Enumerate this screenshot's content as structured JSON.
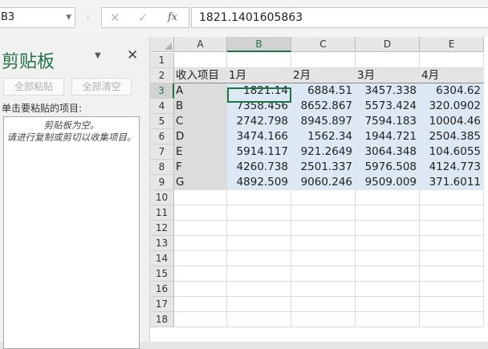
{
  "formula_bar": {
    "name_box": "B3",
    "formula": "1821.1401605863",
    "cancel_symbol": "✕",
    "confirm_symbol": "✓",
    "fx_label": "fx"
  },
  "clipboard_pane": {
    "title": "剪贴板",
    "paste_all": "全部粘贴",
    "clear_all": "全部清空",
    "hint": "单击要粘贴的项目:",
    "empty_line1": "剪贴板为空。",
    "empty_line2": "请进行复制或剪切以收集项目。"
  },
  "sheet": {
    "active_cell": "B3",
    "columns": [
      "A",
      "B",
      "C",
      "D",
      "E"
    ],
    "row_numbers": [
      1,
      2,
      3,
      4,
      5,
      6,
      7,
      8,
      9,
      10,
      11,
      12,
      13,
      14,
      15,
      16,
      17,
      18
    ],
    "header_row": [
      "收入项目",
      "1月",
      "2月",
      "3月",
      "4月"
    ],
    "data_rows": [
      {
        "label": "A",
        "values": [
          "1821.14",
          "6884.51",
          "3457.338",
          "6304.62"
        ]
      },
      {
        "label": "B",
        "values": [
          "7358.456",
          "8652.867",
          "5573.424",
          "320.0902"
        ]
      },
      {
        "label": "C",
        "values": [
          "2742.798",
          "8945.897",
          "7594.183",
          "10004.46"
        ]
      },
      {
        "label": "D",
        "values": [
          "3474.166",
          "1562.34",
          "1944.721",
          "2504.385"
        ]
      },
      {
        "label": "E",
        "values": [
          "5914.117",
          "921.2649",
          "3064.348",
          "104.6055"
        ]
      },
      {
        "label": "F",
        "values": [
          "4260.738",
          "2501.337",
          "5976.508",
          "4124.773"
        ]
      },
      {
        "label": "G",
        "values": [
          "4892.509",
          "9060.246",
          "9509.009",
          "371.6011"
        ]
      }
    ]
  },
  "colors": {
    "accent": "#217346",
    "data_fill": "#dce8f3",
    "label_fill": "#dcdcdc"
  }
}
